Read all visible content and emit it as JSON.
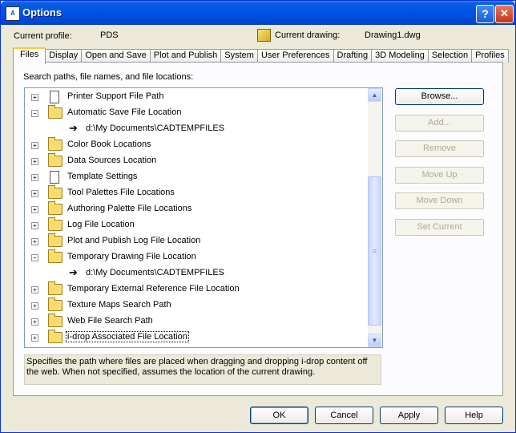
{
  "window": {
    "title": "Options"
  },
  "header": {
    "profile_label": "Current profile:",
    "profile_value": "PDS",
    "drawing_label": "Current drawing:",
    "drawing_value": "Drawing1.dwg"
  },
  "tabs": [
    "Files",
    "Display",
    "Open and Save",
    "Plot and Publish",
    "System",
    "User Preferences",
    "Drafting",
    "3D Modeling",
    "Selection",
    "Profiles"
  ],
  "active_tab": "Files",
  "files": {
    "search_label": "Search paths, file names, and file locations:",
    "tree": [
      {
        "label": "Printer Support File Path",
        "icon": "doc-icon",
        "expander": "+",
        "child": false,
        "selected": false
      },
      {
        "label": "Automatic Save File Location",
        "icon": "folder-icon",
        "expander": "−",
        "child": false,
        "selected": false
      },
      {
        "label": "d:\\My Documents\\CADTEMPFILES",
        "icon": "path-arrow-icon",
        "expander": "",
        "child": true,
        "selected": false
      },
      {
        "label": "Color Book Locations",
        "icon": "folder-icon",
        "expander": "+",
        "child": false,
        "selected": false
      },
      {
        "label": "Data Sources Location",
        "icon": "folder-icon",
        "expander": "+",
        "child": false,
        "selected": false
      },
      {
        "label": "Template Settings",
        "icon": "doc-icon",
        "expander": "+",
        "child": false,
        "selected": false
      },
      {
        "label": "Tool Palettes File Locations",
        "icon": "folder-icon",
        "expander": "+",
        "child": false,
        "selected": false
      },
      {
        "label": "Authoring Palette File Locations",
        "icon": "folder-icon",
        "expander": "+",
        "child": false,
        "selected": false
      },
      {
        "label": "Log File Location",
        "icon": "folder-icon",
        "expander": "+",
        "child": false,
        "selected": false
      },
      {
        "label": "Plot and Publish Log File Location",
        "icon": "folder-icon",
        "expander": "+",
        "child": false,
        "selected": false
      },
      {
        "label": "Temporary Drawing File Location",
        "icon": "folder-icon",
        "expander": "−",
        "child": false,
        "selected": false
      },
      {
        "label": "d:\\My Documents\\CADTEMPFILES",
        "icon": "path-arrow-icon",
        "expander": "",
        "child": true,
        "selected": false
      },
      {
        "label": "Temporary External Reference File Location",
        "icon": "folder-icon",
        "expander": "+",
        "child": false,
        "selected": false
      },
      {
        "label": "Texture Maps Search Path",
        "icon": "folder-icon",
        "expander": "+",
        "child": false,
        "selected": false
      },
      {
        "label": "Web File Search Path",
        "icon": "folder-icon",
        "expander": "+",
        "child": false,
        "selected": false
      },
      {
        "label": "i-drop Associated File Location",
        "icon": "folder-icon",
        "expander": "+",
        "child": false,
        "selected": true
      }
    ],
    "description": "Specifies the path where files are placed when dragging and dropping i-drop content off the web.  When not specified, assumes the location of the current drawing.",
    "buttons": {
      "browse": "Browse...",
      "add": "Add...",
      "remove": "Remove",
      "move_up": "Move Up",
      "move_down": "Move Down",
      "set_current": "Set Current"
    }
  },
  "footer": {
    "ok": "OK",
    "cancel": "Cancel",
    "apply": "Apply",
    "help": "Help"
  }
}
